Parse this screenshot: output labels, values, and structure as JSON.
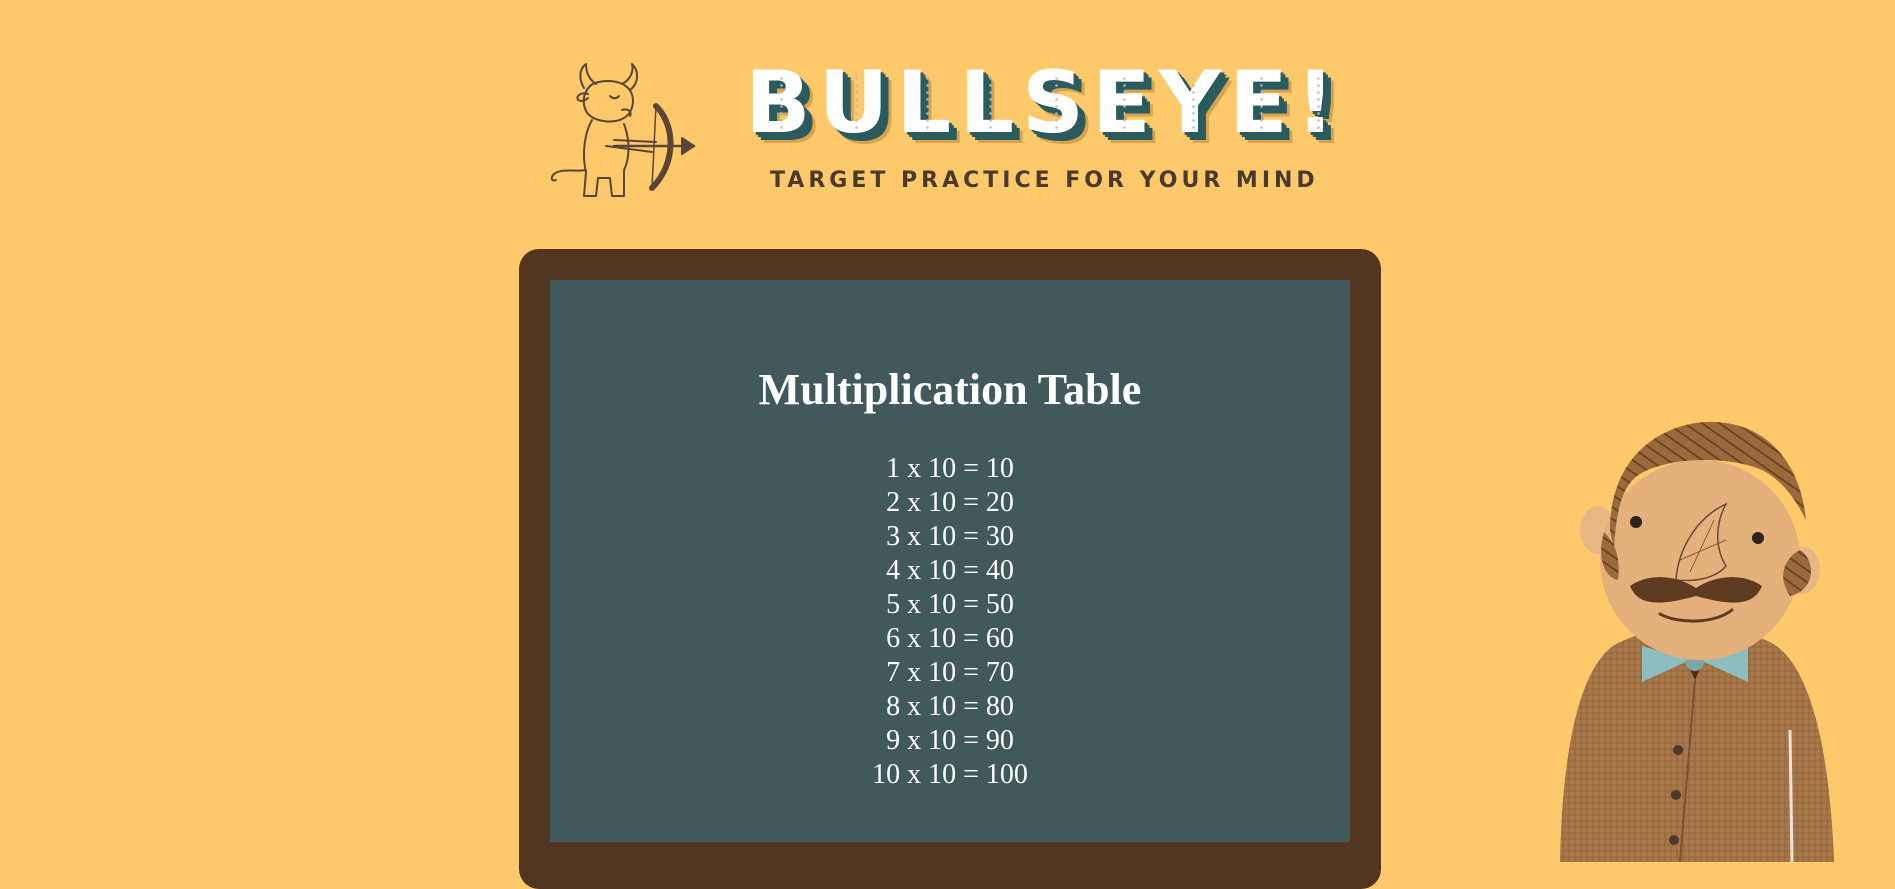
{
  "header": {
    "logo_letters": [
      "B",
      "U",
      "L",
      "L",
      "S",
      "E",
      "Y",
      "E",
      "!"
    ],
    "tagline": "TARGET PRACTICE FOR YOUR MIND",
    "mascot_icon": "bull-archer-icon"
  },
  "board": {
    "title": "Multiplication Table",
    "rows": [
      "1 x 10 = 10",
      "2 x 10 = 20",
      "3 x 10 = 30",
      "4 x 10 = 40",
      "5 x 10 = 50",
      "6 x 10 = 60",
      "7 x 10 = 70",
      "8 x 10 = 80",
      "9 x 10 = 90",
      "10 x 10 = 100"
    ]
  },
  "character": {
    "icon": "professor-illustration"
  },
  "colors": {
    "background": "#FEC96A",
    "frame": "#52351F",
    "board": "#41595A",
    "logo_teal": "#2A5B5E",
    "tagline": "#4A3A2E"
  }
}
